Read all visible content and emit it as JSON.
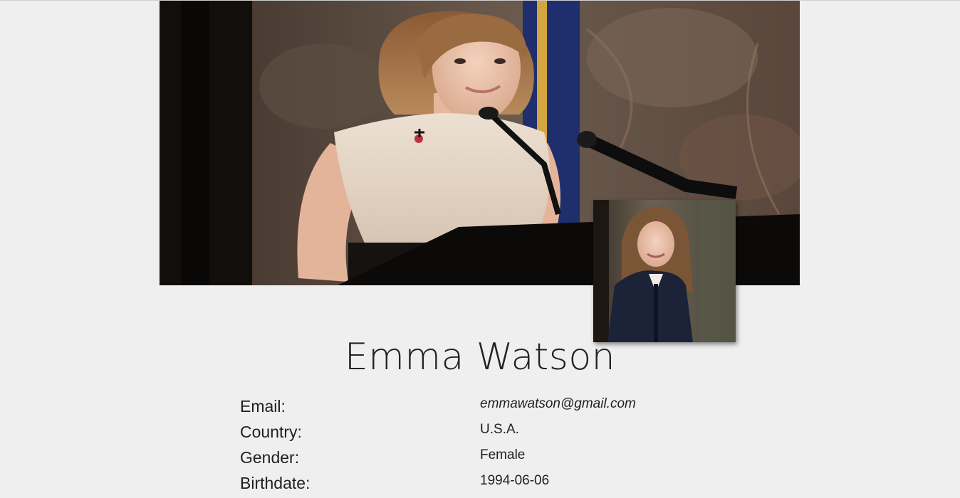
{
  "profile": {
    "name": "Emma Watson",
    "fields": [
      {
        "label": "Email:",
        "value": "emmawatson@gmail.com"
      },
      {
        "label": "Country:",
        "value": "U.S.A."
      },
      {
        "label": "Gender:",
        "value": "Female"
      },
      {
        "label": "Birthdate:",
        "value": "1994-06-06"
      }
    ]
  },
  "colors": {
    "page_background": "#efefef",
    "text": "#1f1f1f"
  }
}
